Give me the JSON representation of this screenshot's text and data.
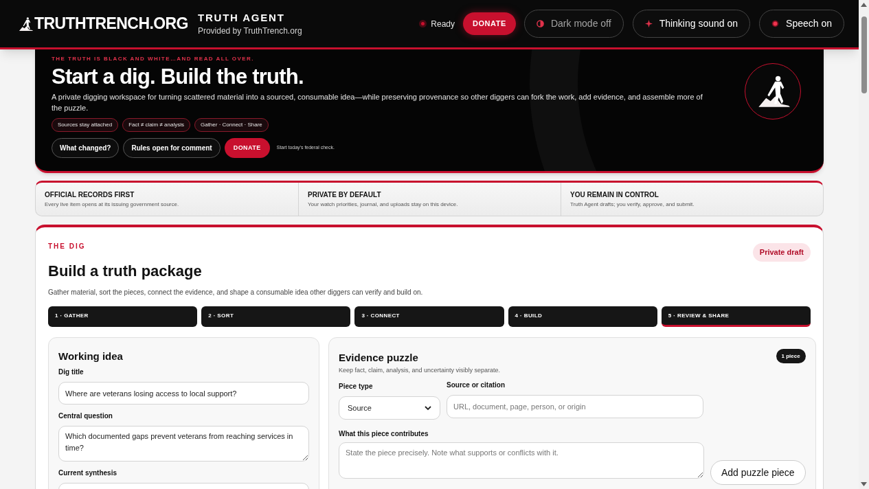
{
  "header": {
    "logo_text": "TRUTHTRENCH.ORG",
    "app_title": "TRUTH AGENT",
    "app_subtitle": "Provided by TruthTrench.org",
    "status": {
      "label": "Ready"
    },
    "donate": "DONATE",
    "toggles": [
      {
        "kind": "theme",
        "label": "Dark mode off",
        "on": false
      },
      {
        "kind": "sound",
        "label": "Thinking sound on",
        "on": true
      },
      {
        "kind": "speech",
        "label": "Speech on",
        "on": true
      }
    ]
  },
  "hero": {
    "kicker": "THE TRUTH IS BLACK AND WHITE…AND READ ALL OVER.",
    "title": "Start a dig. Build the truth.",
    "description": "A private digging workspace for turning scattered material into a sourced, consumable idea—while preserving provenance so other diggers can fork the work, add evidence, and assemble more of the puzzle.",
    "tags": [
      "Sources stay attached",
      "Fact ≠ claim ≠ analysis",
      "Gather · Connect · Share"
    ],
    "buttons": [
      {
        "kind": "outline",
        "label": "What changed?"
      },
      {
        "kind": "outline",
        "label": "Rules open for comment"
      },
      {
        "kind": "primary",
        "label": "DONATE"
      }
    ],
    "note": "Start today's federal check."
  },
  "features": [
    {
      "title": "OFFICIAL RECORDS FIRST",
      "text": "Every live item opens at its issuing government source."
    },
    {
      "title": "PRIVATE BY DEFAULT",
      "text": "Your watch priorities, journal, and uploads stay on this device."
    },
    {
      "title": "YOU REMAIN IN CONTROL",
      "text": "Truth Agent drafts; you verify, approve, and submit."
    }
  ],
  "dig": {
    "kicker": "THE DIG",
    "title": "Build a truth package",
    "badge": "Private draft",
    "description": "Gather material, sort the pieces, connect the evidence, and shape a consumable idea other diggers can verify and build on.",
    "steps": [
      {
        "label": "1 · GATHER",
        "selected": false
      },
      {
        "label": "2 · SORT",
        "selected": false
      },
      {
        "label": "3 · CONNECT",
        "selected": false
      },
      {
        "label": "4 · BUILD",
        "selected": false
      },
      {
        "label": "5 · REVIEW & SHARE",
        "selected": true
      }
    ],
    "working_idea": {
      "title": "Working idea",
      "fields": [
        {
          "kind": "input",
          "label": "Dig title",
          "value": "Where are veterans losing access to local support?"
        },
        {
          "kind": "textarea",
          "label": "Central question",
          "value": "Which documented gaps prevent veterans from reaching services in time?"
        },
        {
          "kind": "textarea",
          "label": "Current synthesis"
        }
      ]
    },
    "evidence": {
      "title": "Evidence puzzle",
      "count": "1 piece",
      "description": "Keep fact, claim, analysis, and uncertainty visibly separate.",
      "piece_type": {
        "label": "Piece type",
        "value": "Source"
      },
      "source": {
        "label": "Source or citation",
        "placeholder": "URL, document, page, person, or origin"
      },
      "contribution": {
        "label": "What this piece contributes",
        "placeholder": "State the piece precisely. Note what supports or conflicts with it."
      },
      "add_button": "Add puzzle piece"
    }
  }
}
